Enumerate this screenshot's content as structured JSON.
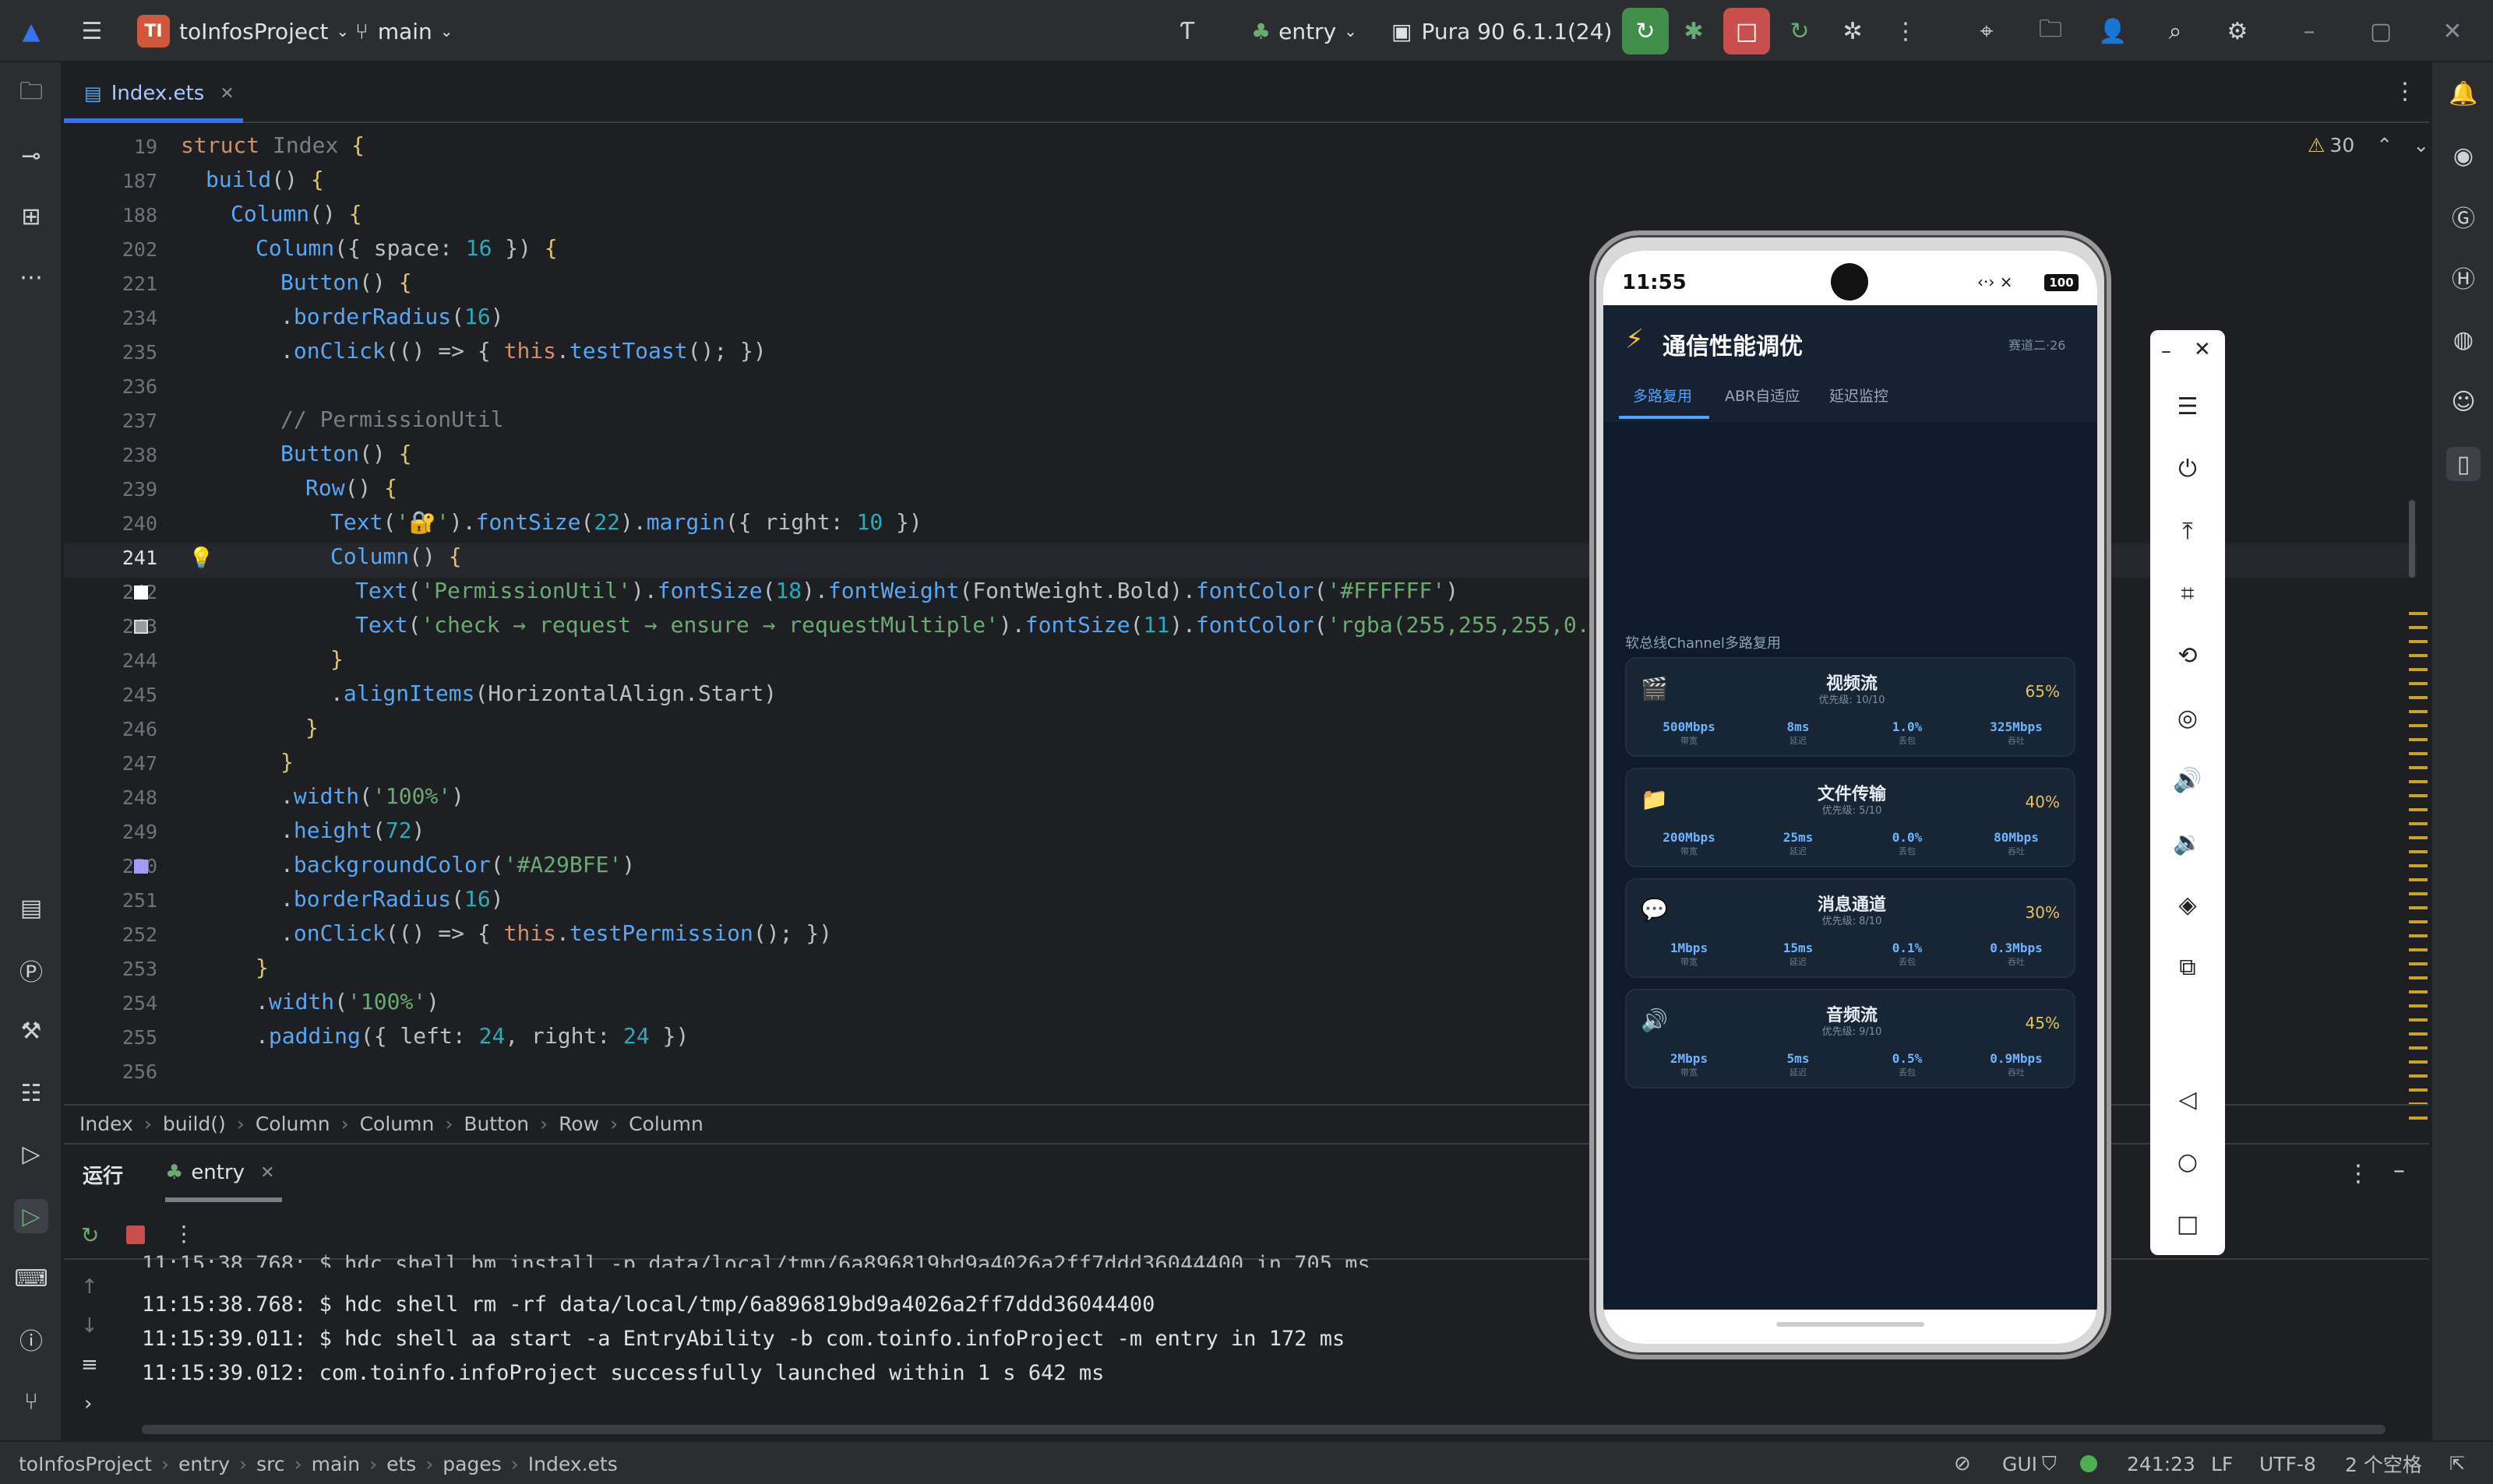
{
  "titlebar": {
    "project_badge": "TI",
    "project_name": "toInfosProject",
    "branch": "main",
    "run_config": "entry",
    "device": "Pura 90 6.1.1(24)"
  },
  "editor": {
    "tab_name": "Index.ets",
    "warning_count": "30",
    "lines": [
      {
        "n": "19",
        "html": "<span class=\"kw\">struct</span> <span class=\"dim\">Index</span> <span class=\"br\">{</span>",
        "indent": 0
      },
      {
        "n": "187",
        "html": "<span class=\"fn\">build</span>() <span class=\"br\">{</span>",
        "indent": 1
      },
      {
        "n": "188",
        "html": "<span class=\"fn\">Column</span>() <span class=\"br\">{</span>",
        "indent": 2
      },
      {
        "n": "202",
        "html": "<span class=\"fn\">Column</span>({ space: <span class=\"num\">16</span> }) <span class=\"br\">{</span>",
        "indent": 3
      },
      {
        "n": "221",
        "html": "<span class=\"fn\">Button</span>() <span class=\"br\">{</span>",
        "indent": 4
      },
      {
        "n": "234",
        "html": ".<span class=\"fn\">borderRadius</span>(<span class=\"num\">16</span>)",
        "indent": 4
      },
      {
        "n": "235",
        "html": ".<span class=\"fn\">onClick</span>(() => { <span class=\"kw\">this</span>.<span class=\"fn\">testToast</span>(); })",
        "indent": 4
      },
      {
        "n": "236",
        "html": "",
        "indent": 4
      },
      {
        "n": "237",
        "html": "<span class=\"cmt\">// PermissionUtil</span>",
        "indent": 4
      },
      {
        "n": "238",
        "html": "<span class=\"fn\">Button</span>() <span class=\"br\">{</span>",
        "indent": 4
      },
      {
        "n": "239",
        "html": "<span class=\"fn\">Row</span>() <span class=\"br\">{</span>",
        "indent": 5
      },
      {
        "n": "240",
        "html": "<span class=\"fn\">Text</span>(<span class=\"str\">'🔐'</span>).<span class=\"fn\">fontSize</span>(<span class=\"num\">22</span>).<span class=\"fn\">margin</span>({ right: <span class=\"num\">10</span> })",
        "indent": 6
      },
      {
        "n": "241",
        "html": "<span class=\"fn\">Column</span>() <span class=\"br\">{</span>",
        "indent": 6
      },
      {
        "n": "242",
        "html": "<span class=\"fn\">Text</span>(<span class=\"str\">'PermissionUtil'</span>).<span class=\"fn\">fontSize</span>(<span class=\"num\">18</span>).<span class=\"fn\">fontWeight</span>(FontWeight.Bold).<span class=\"fn\">fontColor</span>(<span class=\"str\">'#FFFFFF'</span>)",
        "indent": 7
      },
      {
        "n": "243",
        "html": "<span class=\"fn\">Text</span>(<span class=\"str\">'check → request → ensure → requestMultiple'</span>).<span class=\"fn\">fontSize</span>(<span class=\"num\">11</span>).<span class=\"fn\">fontColor</span>(<span class=\"str\">'rgba(255,255,255,0.6)'</span>)",
        "indent": 7
      },
      {
        "n": "244",
        "html": "<span class=\"br\">}</span>",
        "indent": 6
      },
      {
        "n": "245",
        "html": ".<span class=\"fn\">alignItems</span>(HorizontalAlign.Start)",
        "indent": 6
      },
      {
        "n": "246",
        "html": "<span class=\"br\">}</span>",
        "indent": 5
      },
      {
        "n": "247",
        "html": "<span class=\"br\">}</span>",
        "indent": 4
      },
      {
        "n": "248",
        "html": ".<span class=\"fn\">width</span>(<span class=\"str\">'100%'</span>)",
        "indent": 4
      },
      {
        "n": "249",
        "html": ".<span class=\"fn\">height</span>(<span class=\"num\">72</span>)",
        "indent": 4
      },
      {
        "n": "250",
        "html": ".<span class=\"fn\">backgroundColor</span>(<span class=\"str\">'#A29BFE'</span>)",
        "indent": 4
      },
      {
        "n": "251",
        "html": ".<span class=\"fn\">borderRadius</span>(<span class=\"num\">16</span>)",
        "indent": 4
      },
      {
        "n": "252",
        "html": ".<span class=\"fn\">onClick</span>(() => { <span class=\"kw\">this</span>.<span class=\"fn\">testPermission</span>(); })",
        "indent": 4
      },
      {
        "n": "253",
        "html": "<span class=\"br\">}</span>",
        "indent": 3
      },
      {
        "n": "254",
        "html": ".<span class=\"fn\">width</span>(<span class=\"str\">'100%'</span>)",
        "indent": 3
      },
      {
        "n": "255",
        "html": ".<span class=\"fn\">padding</span>({ left: <span class=\"num\">24</span>, right: <span class=\"num\">24</span> })",
        "indent": 3
      },
      {
        "n": "256",
        "html": "",
        "indent": 3
      }
    ],
    "breadcrumb": [
      "Index",
      "build()",
      "Column",
      "Column",
      "Button",
      "Row",
      "Column"
    ]
  },
  "run_panel": {
    "title": "运行",
    "tab": "entry",
    "logs": [
      "11:15:38.768: $ hdc shell rm -rf data/local/tmp/6a896819bd9a4026a2ff7ddd36044400",
      "11:15:39.011: $ hdc shell aa start -a EntryAbility -b com.toinfo.infoProject -m entry in 172 ms",
      "11:15:39.012: com.toinfo.infoProject successfully launched within 1 s 642 ms"
    ]
  },
  "statusbar": {
    "path": [
      "toInfosProject",
      "entry",
      "src",
      "main",
      "ets",
      "pages",
      "Index.ets"
    ],
    "gui": "GUI",
    "position": "241:23",
    "line_ending": "LF",
    "encoding": "UTF-8",
    "indent": "2 个空格"
  },
  "phone": {
    "time": "11:55",
    "battery": "100",
    "app_title": "通信性能调优",
    "app_tag": "赛道二·26",
    "tabs": [
      "多路复用",
      "ABR自适应",
      "延迟监控"
    ],
    "section_label": "软总线Channel多路复用",
    "channels": [
      {
        "icon": "🎬",
        "title": "视频流",
        "priority": "优先级: 10/10",
        "pct": "65%",
        "metrics": [
          [
            "500Mbps",
            "带宽"
          ],
          [
            "8ms",
            "延迟"
          ],
          [
            "1.0%",
            "丢包"
          ],
          [
            "325Mbps",
            "吞吐"
          ]
        ]
      },
      {
        "icon": "📁",
        "title": "文件传输",
        "priority": "优先级: 5/10",
        "pct": "40%",
        "metrics": [
          [
            "200Mbps",
            "带宽"
          ],
          [
            "25ms",
            "延迟"
          ],
          [
            "0.0%",
            "丢包"
          ],
          [
            "80Mbps",
            "吞吐"
          ]
        ]
      },
      {
        "icon": "💬",
        "title": "消息通道",
        "priority": "优先级: 8/10",
        "pct": "30%",
        "metrics": [
          [
            "1Mbps",
            "带宽"
          ],
          [
            "15ms",
            "延迟"
          ],
          [
            "0.1%",
            "丢包"
          ],
          [
            "0.3Mbps",
            "吞吐"
          ]
        ]
      },
      {
        "icon": "🔊",
        "title": "音频流",
        "priority": "优先级: 9/10",
        "pct": "45%",
        "metrics": [
          [
            "2Mbps",
            "带宽"
          ],
          [
            "5ms",
            "延迟"
          ],
          [
            "0.5%",
            "丢包"
          ],
          [
            "0.9Mbps",
            "吞吐"
          ]
        ]
      }
    ]
  },
  "colors": {
    "accent": "#3574f0",
    "run_green": "#4caf50",
    "stop_red": "#e05555",
    "pct_gold": "#e6c35c"
  }
}
